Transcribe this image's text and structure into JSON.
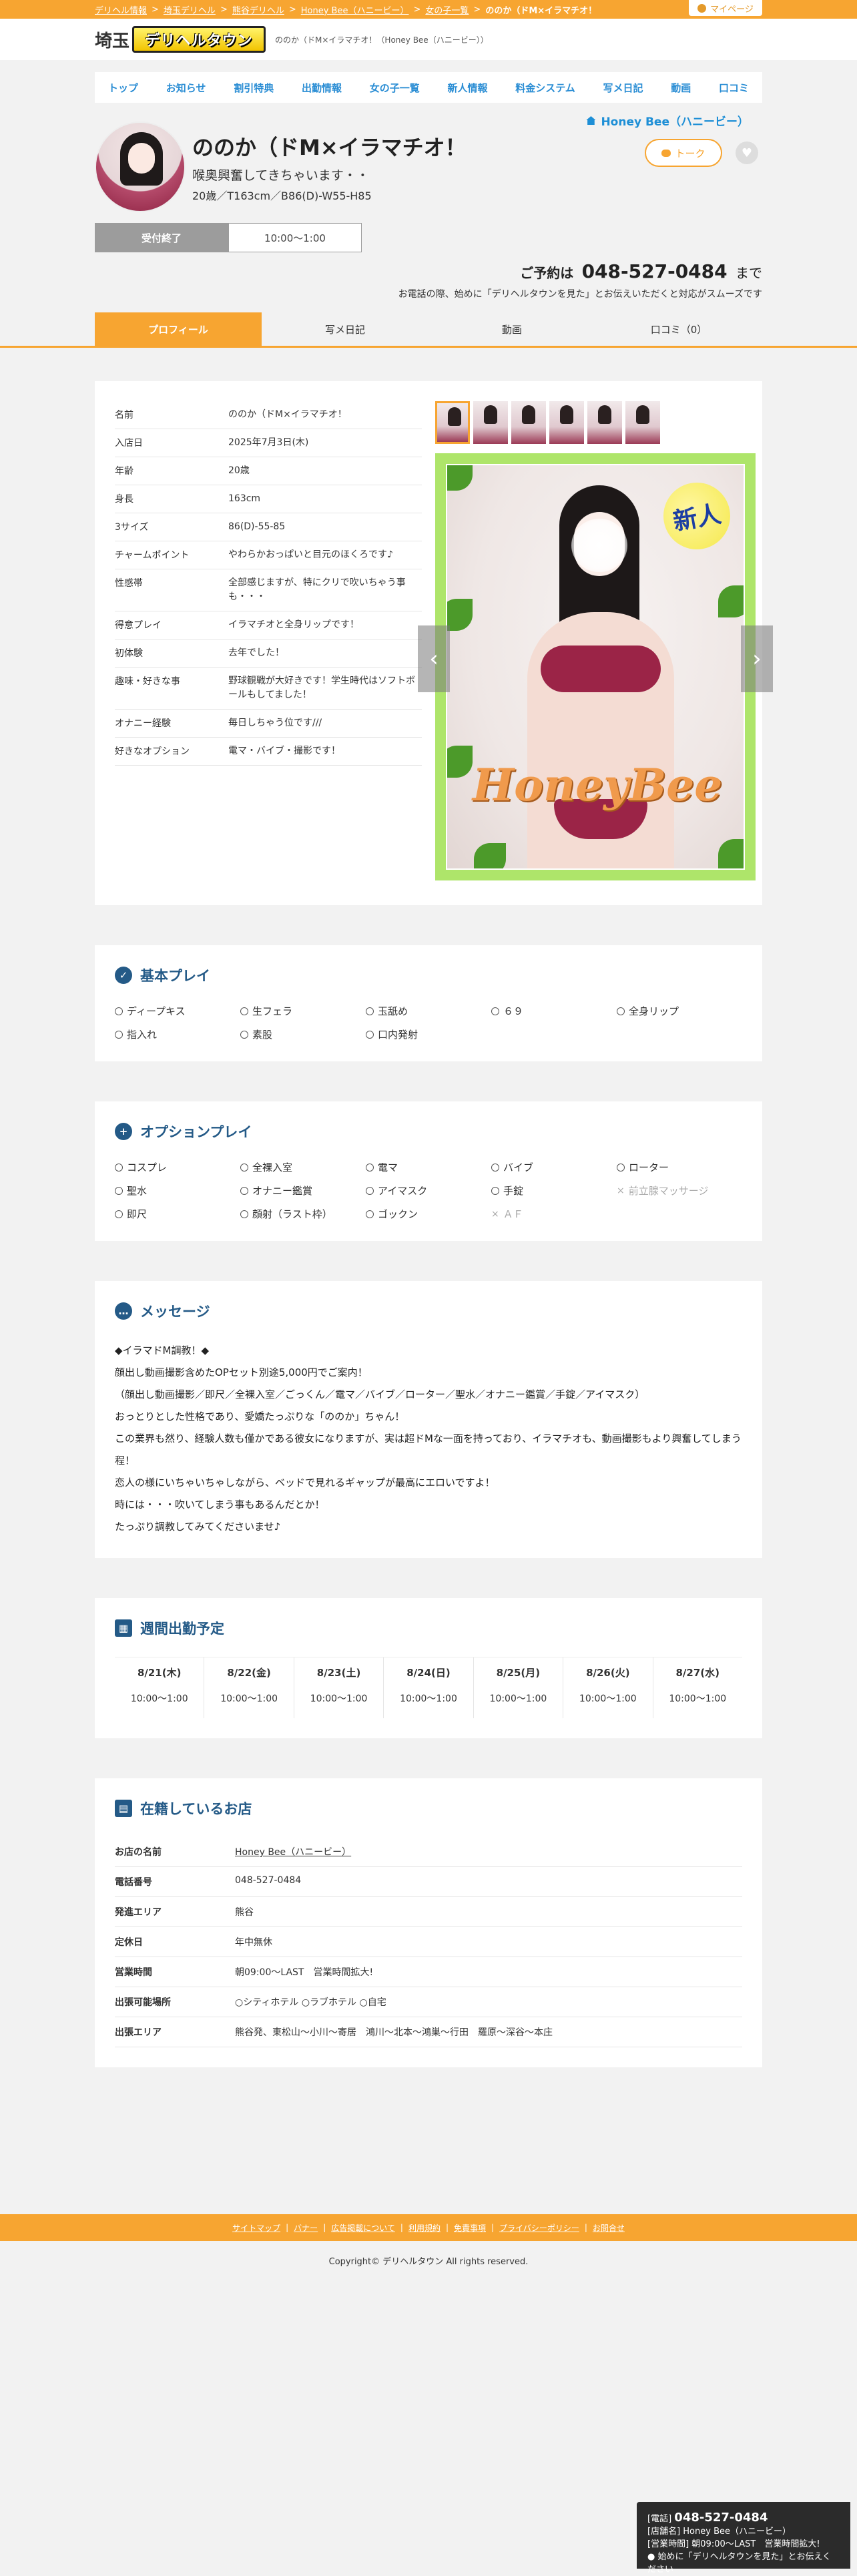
{
  "breadcrumbs": [
    "デリヘル情報",
    "埼玉デリヘル",
    "熊谷デリヘル",
    "Honey Bee（ハニービー）",
    "女の子一覧",
    "ののか（ドM×イラマチオ！"
  ],
  "mypage": "マイページ",
  "header": {
    "region": "埼玉",
    "logo_text": "デリヘルタウン",
    "tagline": "ののか（ドM×イラマチオ！（Honey Bee（ハニービー））"
  },
  "nav": [
    "トップ",
    "お知らせ",
    "割引特典",
    "出勤情報",
    "女の子一覧",
    "新人情報",
    "料金システム",
    "写メ日記",
    "動画",
    "口コミ"
  ],
  "profile": {
    "shop_link": "Honey Bee（ハニービー）",
    "name": "ののか（ドM×イラマチオ！",
    "catch": "喉奥興奮してきちゃいます・・",
    "spec": "20歳／T163cm／B86(D)-W55-H85",
    "talk": "トーク",
    "fav": "♥",
    "status_done": "受付終了",
    "status_hours": "10:00〜1:00",
    "reserve_label": "ご予約は",
    "reserve_tel": "048-527-0484",
    "reserve_suffix": "まで",
    "reserve_note": "お電話の際、始めに「デリヘルタウンを見た」とお伝えいただくと対応がスムーズです"
  },
  "tabs": [
    "プロフィール",
    "写メ日記",
    "動画",
    "口コミ（0）"
  ],
  "details": [
    {
      "k": "名前",
      "v": "ののか（ドM×イラマチオ！"
    },
    {
      "k": "入店日",
      "v": "2025年7月3日(木)"
    },
    {
      "k": "年齢",
      "v": "20歳"
    },
    {
      "k": "身長",
      "v": "163cm"
    },
    {
      "k": "3サイズ",
      "v": "86(D)-55-85"
    },
    {
      "k": "チャームポイント",
      "v": "やわらかおっぱいと目元のほくろです♪"
    },
    {
      "k": "性感帯",
      "v": "全部感じますが、特にクリで吹いちゃう事も・・・"
    },
    {
      "k": "得意プレイ",
      "v": "イラマチオと全身リップです！"
    },
    {
      "k": "初体験",
      "v": "去年でした！"
    },
    {
      "k": "趣味・好きな事",
      "v": "野球観戦が大好きです！学生時代はソフトボールもしてました！"
    },
    {
      "k": "オナニー経験",
      "v": "毎日しちゃう位です///"
    },
    {
      "k": "好きなオプション",
      "v": "電マ・バイブ・撮影です！"
    }
  ],
  "photo": {
    "badge": "新人",
    "logo": "HoneyBee",
    "prev": "‹",
    "next": "›"
  },
  "basic_play": {
    "title": "基本プレイ",
    "items": [
      {
        "label": "ディープキス",
        "ok": true
      },
      {
        "label": "生フェラ",
        "ok": true
      },
      {
        "label": "玉舐め",
        "ok": true
      },
      {
        "label": "６９",
        "ok": true
      },
      {
        "label": "全身リップ",
        "ok": true
      },
      {
        "label": "指入れ",
        "ok": true
      },
      {
        "label": "素股",
        "ok": true
      },
      {
        "label": "口内発射",
        "ok": true
      }
    ]
  },
  "option_play": {
    "title": "オプションプレイ",
    "items": [
      {
        "label": "コスプレ",
        "ok": true
      },
      {
        "label": "全裸入室",
        "ok": true
      },
      {
        "label": "電マ",
        "ok": true
      },
      {
        "label": "バイブ",
        "ok": true
      },
      {
        "label": "ローター",
        "ok": true
      },
      {
        "label": "聖水",
        "ok": true
      },
      {
        "label": "オナニー鑑賞",
        "ok": true
      },
      {
        "label": "アイマスク",
        "ok": true
      },
      {
        "label": "手錠",
        "ok": true
      },
      {
        "label": "前立腺マッサージ",
        "ok": false
      },
      {
        "label": "即尺",
        "ok": true
      },
      {
        "label": "顔射（ラスト枠）",
        "ok": true
      },
      {
        "label": "ゴックン",
        "ok": true
      },
      {
        "label": "ＡＦ",
        "ok": false
      }
    ]
  },
  "message": {
    "title": "メッセージ",
    "lines": [
      "◆イラマドM調教！◆",
      "顔出し動画撮影含めたOPセット別途5,000円でご案内！",
      "（顔出し動画撮影／即尺／全裸入室／ごっくん／電マ／バイブ／ローター／聖水／オナニー鑑賞／手錠／アイマスク）",
      "おっとりとした性格であり、愛嬌たっぷりな「ののか」ちゃん！",
      "この業界も然り、経験人数も僅かである彼女になりますが、実は超ドMな一面を持っており、イラマチオも、動画撮影もより興奮してしまう程！",
      "恋人の様にいちゃいちゃしながら、ベッドで見れるギャップが最高にエロいですよ！",
      "時には・・・吹いてしまう事もあるんだとか！",
      "たっぷり調教してみてくださいませ♪"
    ]
  },
  "schedule": {
    "title": "週間出勤予定",
    "days": [
      {
        "d": "8/21(木)",
        "t": "10:00〜1:00"
      },
      {
        "d": "8/22(金)",
        "t": "10:00〜1:00"
      },
      {
        "d": "8/23(土)",
        "t": "10:00〜1:00"
      },
      {
        "d": "8/24(日)",
        "t": "10:00〜1:00"
      },
      {
        "d": "8/25(月)",
        "t": "10:00〜1:00"
      },
      {
        "d": "8/26(火)",
        "t": "10:00〜1:00"
      },
      {
        "d": "8/27(水)",
        "t": "10:00〜1:00"
      }
    ]
  },
  "shop": {
    "title": "在籍しているお店",
    "rows": [
      {
        "k": "お店の名前",
        "v": "Honey Bee（ハニービー）"
      },
      {
        "k": "電話番号",
        "v": "048-527-0484"
      },
      {
        "k": "発進エリア",
        "v": "熊谷"
      },
      {
        "k": "定休日",
        "v": "年中無休"
      },
      {
        "k": "営業時間",
        "v": "朝09:00〜LAST　営業時間拡大!"
      },
      {
        "k": "出張可能場所",
        "v": "○シティホテル ○ラブホテル ○自宅"
      },
      {
        "k": "出張エリア",
        "v": "熊谷発、東松山〜小川〜寄居　鴻川〜北本〜鴻巣〜行田　羅原〜深谷〜本庄"
      }
    ]
  },
  "footer": {
    "links": [
      "サイトマップ",
      "バナー",
      "広告掲載について",
      "利用規約",
      "免責事項",
      "プライバシーポリシー",
      "お問合せ"
    ],
    "copyright": "Copyright© デリヘルタウン All rights reserved."
  },
  "floating": {
    "tel_label": "[電話]",
    "tel": "048-527-0484",
    "shop": "[店舗名] Honey Bee（ハニービー）",
    "hours": "[営業時間] 朝09:00〜LAST　営業時間拡大!",
    "note": "始めに「デリヘルタウンを見た」とお伝えください"
  }
}
